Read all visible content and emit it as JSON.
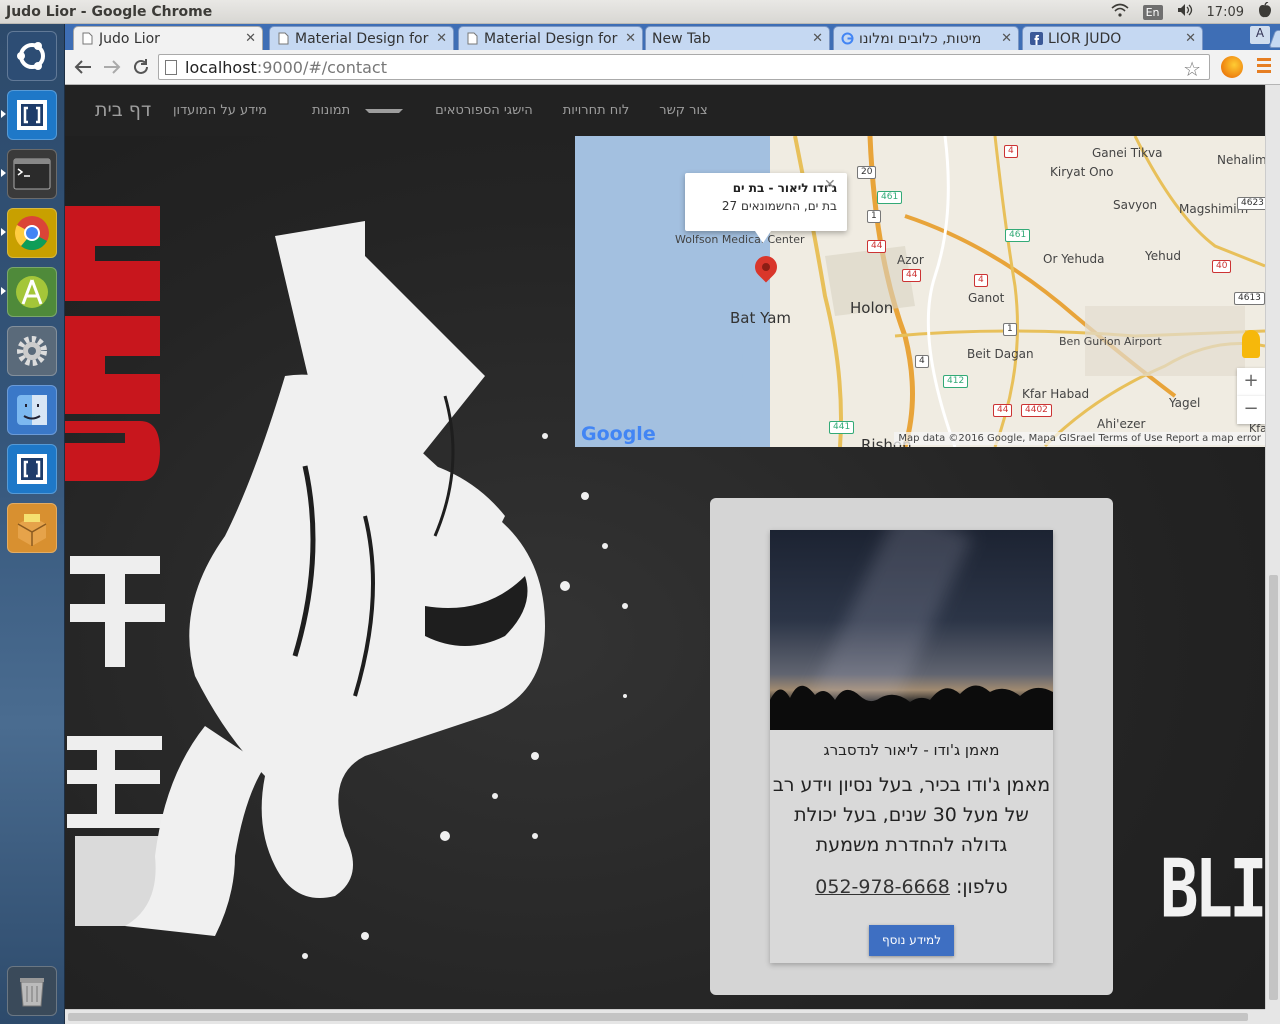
{
  "window": {
    "title": "Judo Lior - Google Chrome"
  },
  "tray": {
    "keyboard": "En",
    "time": "17:09"
  },
  "launcher": {
    "items": [
      "ubuntu-dash-icon",
      "brackets-icon",
      "terminal-icon",
      "chrome-icon",
      "android-studio-icon",
      "settings-icon",
      "finder-icon",
      "brackets-icon-2",
      "package-icon"
    ],
    "trash": "trash-icon"
  },
  "tabs": [
    {
      "label": "Judo Lior",
      "active": true
    },
    {
      "label": "Material Design for",
      "active": false
    },
    {
      "label": "Material Design for",
      "active": false
    },
    {
      "label": "New Tab",
      "active": false
    },
    {
      "label": "מיטות, כלובים ומלונו",
      "active": false
    },
    {
      "label": "LIOR JUDO",
      "active": false
    }
  ],
  "user_button": "A",
  "address": {
    "host": "localhost",
    "path": ":9000/#/contact"
  },
  "nav": {
    "brand": "דף בית",
    "links": [
      "מידע על המועדון",
      "תמונות",
      "הישגי הספורטאים",
      "לוח תחרויות",
      "צור קשר"
    ]
  },
  "map": {
    "info_title": "ג'ודו ליאור - בת ים",
    "info_address": "בת ים, החשמונאים 27",
    "close": "✕",
    "labels": {
      "bat_yam": "Bat Yam",
      "holon": "Holon",
      "azor": "Azor",
      "ganot": "Ganot",
      "or_yehuda": "Or Yehuda",
      "yehud": "Yehud",
      "kiryat_ono": "Kiryat Ono",
      "ganei_tikva": "Ganei Tikva",
      "savyon": "Savyon",
      "magshimim": "Magshimim",
      "nehalim": "Nehalim",
      "beit_dagan": "Beit Dagan",
      "ben_gurion": "Ben Gurion Airport",
      "kfar_habad": "Kfar Habad",
      "yagel": "Yagel",
      "ahiezer": "Ahi'ezer",
      "rishon": "Rishon",
      "wolfson": "Wolfson Medical Center",
      "kfa": "Kfa"
    },
    "shields": [
      "20",
      "4",
      "461",
      "1",
      "44",
      "44",
      "461",
      "4",
      "40",
      "4623",
      "4613",
      "1",
      "412",
      "4",
      "44",
      "4402",
      "441"
    ],
    "zoom_in": "+",
    "zoom_out": "−",
    "google_logo": "Google",
    "attribution": "Map data ©2016 Google, Mapa GISrael    Terms of Use    Report a map error"
  },
  "card": {
    "title": "מאמן ג'ודו - ליאור לנדסברג",
    "body": "מאמן ג'ודו בכיר, בעל נסיון וידע רב של מעל 30 שנים, בעל יכולת גדולה להחדרת משמעת",
    "phone_label": "טלפון:",
    "phone": "052-978-6668",
    "button": "למידע נוסף"
  },
  "blit_text": "BLIT",
  "colors": {
    "navbar": "#222222",
    "accent_red": "#c8161d",
    "button": "#3e6fc2"
  }
}
